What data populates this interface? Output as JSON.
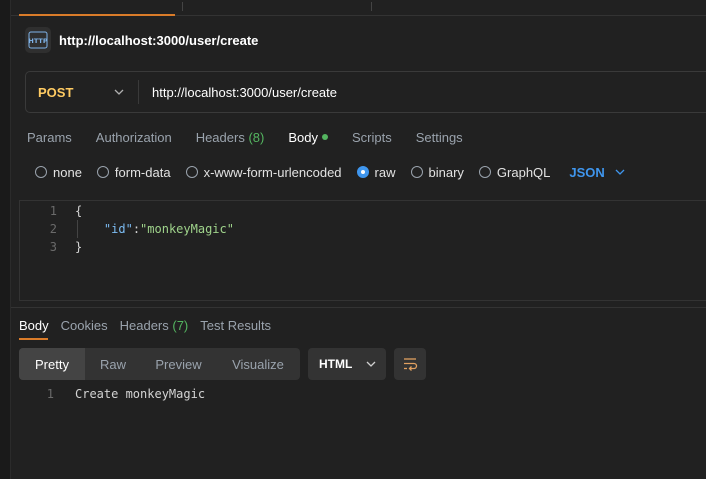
{
  "request": {
    "title": "http://localhost:3000/user/create",
    "icon": "http-file-icon",
    "method": "POST",
    "url": "http://localhost:3000/user/create"
  },
  "request_tabs": [
    {
      "label": "Params"
    },
    {
      "label": "Authorization"
    },
    {
      "label": "Headers ",
      "count": "(8)"
    },
    {
      "label": "Body",
      "active": true
    },
    {
      "label": "Scripts"
    },
    {
      "label": "Settings"
    }
  ],
  "body_types": [
    {
      "label": "none",
      "checked": false
    },
    {
      "label": "form-data",
      "checked": false
    },
    {
      "label": "x-www-form-urlencoded",
      "checked": false
    },
    {
      "label": "raw",
      "checked": true
    },
    {
      "label": "binary",
      "checked": false
    },
    {
      "label": "GraphQL",
      "checked": false
    }
  ],
  "body_language": "JSON",
  "editor": {
    "lines": [
      {
        "num": "1",
        "open": "{"
      },
      {
        "num": "2",
        "key": "\"id\"",
        "sep": ":",
        "value": "\"monkeyMagic\""
      },
      {
        "num": "3",
        "close": "}"
      }
    ]
  },
  "response_tabs": [
    {
      "label": "Body",
      "active": true
    },
    {
      "label": "Cookies"
    },
    {
      "label": "Headers ",
      "count": "(7)"
    },
    {
      "label": "Test Results"
    }
  ],
  "view_modes": [
    "Pretty",
    "Raw",
    "Preview",
    "Visualize"
  ],
  "response_format": "HTML",
  "response": {
    "line_num": "1",
    "text": "Create monkeyMagic"
  },
  "colors": {
    "accent": "#d97b29",
    "method": "#ffcb62",
    "link": "#3f96ee",
    "success": "#54b560"
  }
}
